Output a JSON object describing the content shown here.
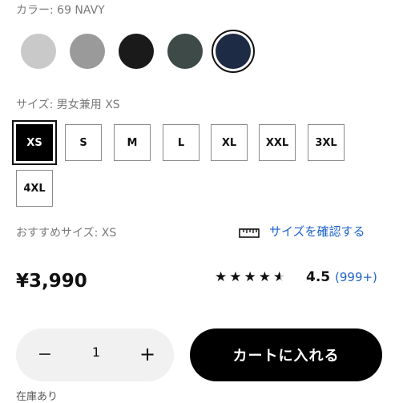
{
  "color": {
    "label": "カラー: 69 NAVY",
    "swatches": [
      {
        "name": "light-gray",
        "hex": "#c9c9c9",
        "selected": false
      },
      {
        "name": "gray",
        "hex": "#9a9a9a",
        "selected": false
      },
      {
        "name": "black",
        "hex": "#1a1a1a",
        "selected": false
      },
      {
        "name": "dark-green",
        "hex": "#3d4a47",
        "selected": false
      },
      {
        "name": "navy",
        "hex": "#1d2b44",
        "selected": true
      }
    ]
  },
  "size": {
    "label": "サイズ: 男女兼用 XS",
    "options": [
      "XS",
      "S",
      "M",
      "L",
      "XL",
      "XXL",
      "3XL",
      "4XL"
    ],
    "selected": "XS"
  },
  "recommend": {
    "label": "おすすめサイズ: XS",
    "check_link": "サイズを確認する",
    "icon": "ruler-icon"
  },
  "price": "¥3,990",
  "rating": {
    "value": "4.5",
    "count": "(999+)",
    "stars": 4.5
  },
  "quantity": {
    "value": "1",
    "minus_symbol": "−",
    "plus_symbol": "+"
  },
  "cart_button": "カートに入れる",
  "stock_text": "在庫あり",
  "colors": {
    "accent_blue": "#1f63c9",
    "button_black": "#000000",
    "pill_bg": "#f1f1f1"
  }
}
